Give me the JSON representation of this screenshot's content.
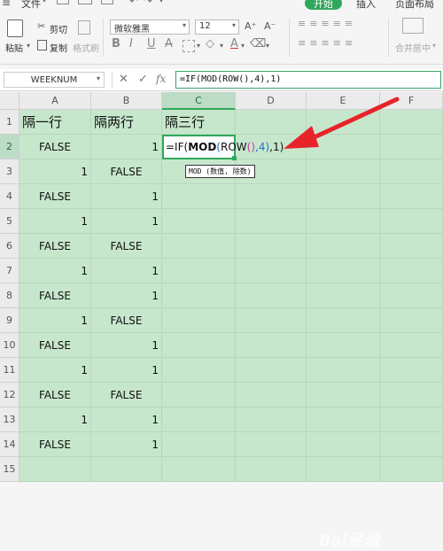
{
  "menu": {
    "file": "文件",
    "tab_home": "开始",
    "tab_insert": "插入",
    "tab_layout": "页面布局"
  },
  "ribbon": {
    "paste": "粘贴",
    "cut": "剪切",
    "copy": "复制",
    "format_painter": "格式刷",
    "font_name": "微软雅黑",
    "font_size": "12",
    "font_grow": "A⁺",
    "font_shrink": "A⁻",
    "merge_center": "合并居中"
  },
  "formula_bar": {
    "name_box": "WEEKNUM",
    "cancel": "✕",
    "confirm": "✓",
    "fx": "fx",
    "formula": "=IF(MOD(ROW(),4),1)"
  },
  "columns": [
    "A",
    "B",
    "C",
    "D",
    "E",
    "F"
  ],
  "rows": [
    {
      "n": "1",
      "a": "隔一行",
      "b": "隔两行",
      "c": "隔三行"
    },
    {
      "n": "2",
      "a": "FALSE",
      "b": "1",
      "c": ""
    },
    {
      "n": "3",
      "a": "1",
      "b": "FALSE",
      "c": ""
    },
    {
      "n": "4",
      "a": "FALSE",
      "b": "1",
      "c": ""
    },
    {
      "n": "5",
      "a": "1",
      "b": "1",
      "c": ""
    },
    {
      "n": "6",
      "a": "FALSE",
      "b": "FALSE",
      "c": ""
    },
    {
      "n": "7",
      "a": "1",
      "b": "1",
      "c": ""
    },
    {
      "n": "8",
      "a": "FALSE",
      "b": "1",
      "c": ""
    },
    {
      "n": "9",
      "a": "1",
      "b": "FALSE",
      "c": ""
    },
    {
      "n": "10",
      "a": "FALSE",
      "b": "1",
      "c": ""
    },
    {
      "n": "11",
      "a": "1",
      "b": "1",
      "c": ""
    },
    {
      "n": "12",
      "a": "FALSE",
      "b": "FALSE",
      "c": ""
    },
    {
      "n": "13",
      "a": "1",
      "b": "1",
      "c": ""
    },
    {
      "n": "14",
      "a": "FALSE",
      "b": "1",
      "c": ""
    },
    {
      "n": "15",
      "a": "",
      "b": "",
      "c": ""
    }
  ],
  "edit_cell": {
    "p1": "=IF(",
    "p2": "MOD",
    "p3": "(",
    "p4": "ROW",
    "p5": "()",
    "p6": ",4)",
    "p7": ",1)"
  },
  "tooltip": "MOD (数值, 除数)",
  "watermark": "Bai经验",
  "colors": {
    "accent": "#2fa85b",
    "cell_fill": "#c7e7cc",
    "arrow": "#e8242b"
  }
}
